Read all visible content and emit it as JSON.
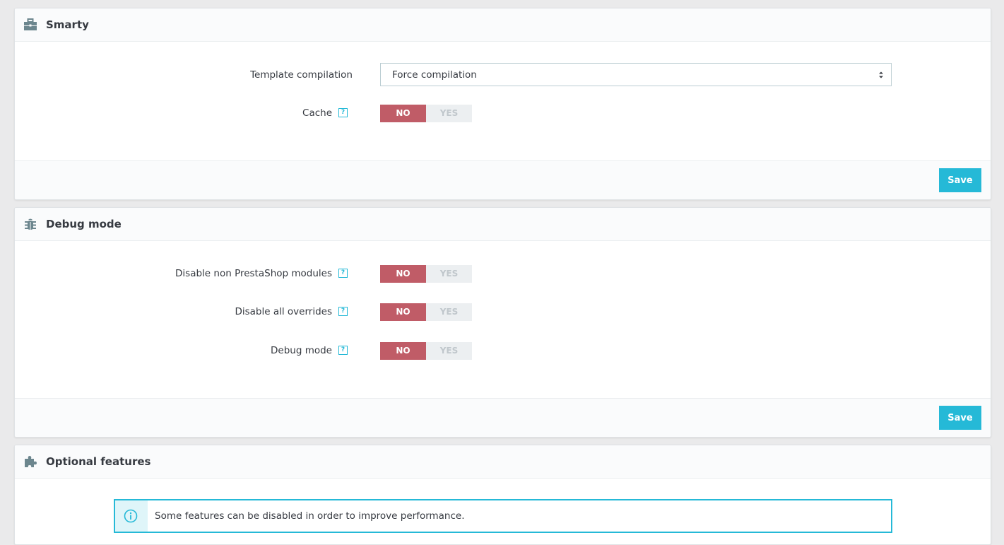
{
  "smarty": {
    "title": "Smarty",
    "icon": "briefcase-icon",
    "template_compilation_label": "Template compilation",
    "template_compilation_value": "Force compilation",
    "cache_label": "Cache",
    "cache_no": "NO",
    "cache_yes": "YES",
    "save_label": "Save"
  },
  "debug": {
    "title": "Debug mode",
    "icon": "bug-icon",
    "disable_modules_label": "Disable non PrestaShop modules",
    "disable_overrides_label": "Disable all overrides",
    "debug_mode_label": "Debug mode",
    "no": "NO",
    "yes": "YES",
    "save_label": "Save"
  },
  "optional": {
    "title": "Optional features",
    "icon": "puzzle-icon",
    "info_text": "Some features can be disabled in order to improve performance."
  },
  "help_glyph": "?",
  "colors": {
    "accent": "#25b9d7",
    "switch_on": "#c05c67",
    "switch_off": "#eceff1"
  }
}
